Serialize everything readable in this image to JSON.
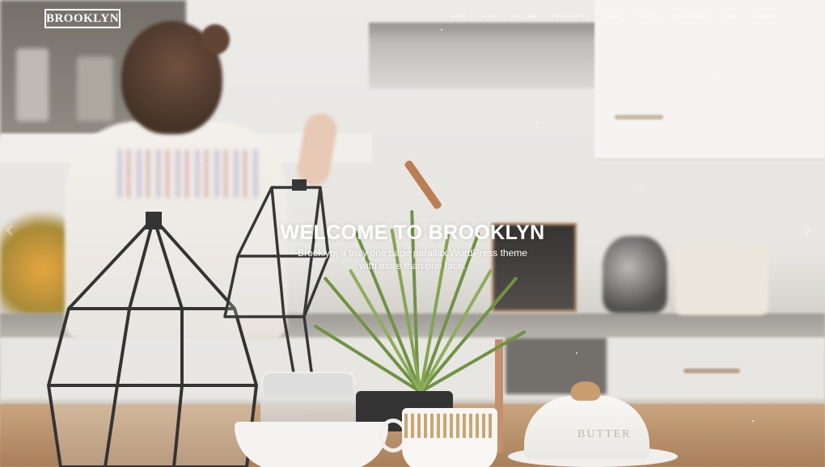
{
  "header": {
    "logo": "BROOKLYN",
    "nav": [
      "HOME",
      "BLOG",
      "WELCOME",
      "POSSIBILITIES",
      "BREAK",
      "CLIENTS",
      "ADVENTURES",
      "TEAM",
      "CONTACT"
    ]
  },
  "hero": {
    "title": "WELCOME TO BROOKLYN",
    "subtitle_line1": "Brooklyn, a truly one page parallax WordPress theme",
    "subtitle_line2": "with more than one face."
  },
  "slider": {
    "prev_icon": "chevron-left-icon",
    "next_icon": "chevron-right-icon"
  },
  "photo": {
    "butter_label": "BUTTER"
  },
  "colors": {
    "text": "#ffffff",
    "wood": "#b38a60",
    "kitchen": "#e8e6e2"
  }
}
